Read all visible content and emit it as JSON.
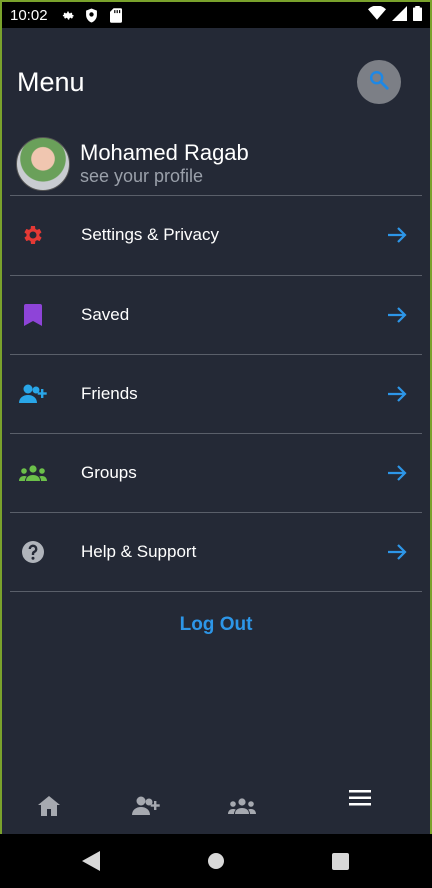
{
  "status_bar": {
    "time": "10:02",
    "icons": [
      "gear-icon",
      "shield-icon",
      "sd-card-icon",
      "wifi-icon",
      "signal-icon",
      "battery-icon"
    ]
  },
  "header": {
    "title": "Menu",
    "search_icon": "search-icon"
  },
  "profile": {
    "name": "Mohamed Ragab",
    "subtitle": "see your profile"
  },
  "menu": {
    "items": [
      {
        "label": "Settings & Privacy",
        "icon": "gear-icon",
        "color": "#e53935"
      },
      {
        "label": "Saved",
        "icon": "bookmark-icon",
        "color": "#8e44d8"
      },
      {
        "label": "Friends",
        "icon": "add-friend-icon",
        "color": "#29a6e8"
      },
      {
        "label": "Groups",
        "icon": "groups-icon",
        "color": "#6cc04a"
      },
      {
        "label": "Help & Support",
        "icon": "help-icon",
        "color": "#b0b4bb"
      }
    ],
    "arrow_color": "#2d96e8"
  },
  "logout": {
    "label": "Log Out",
    "color": "#2d96e8"
  },
  "bottom_nav": {
    "items": [
      "home-icon",
      "friends-icon",
      "groups-icon",
      "menu-icon"
    ],
    "active": "menu-icon"
  },
  "system_nav": [
    "back-icon",
    "home-icon",
    "recents-icon"
  ],
  "colors": {
    "background": "#242936",
    "accent": "#2d96e8",
    "divider": "#5a5f6a"
  }
}
